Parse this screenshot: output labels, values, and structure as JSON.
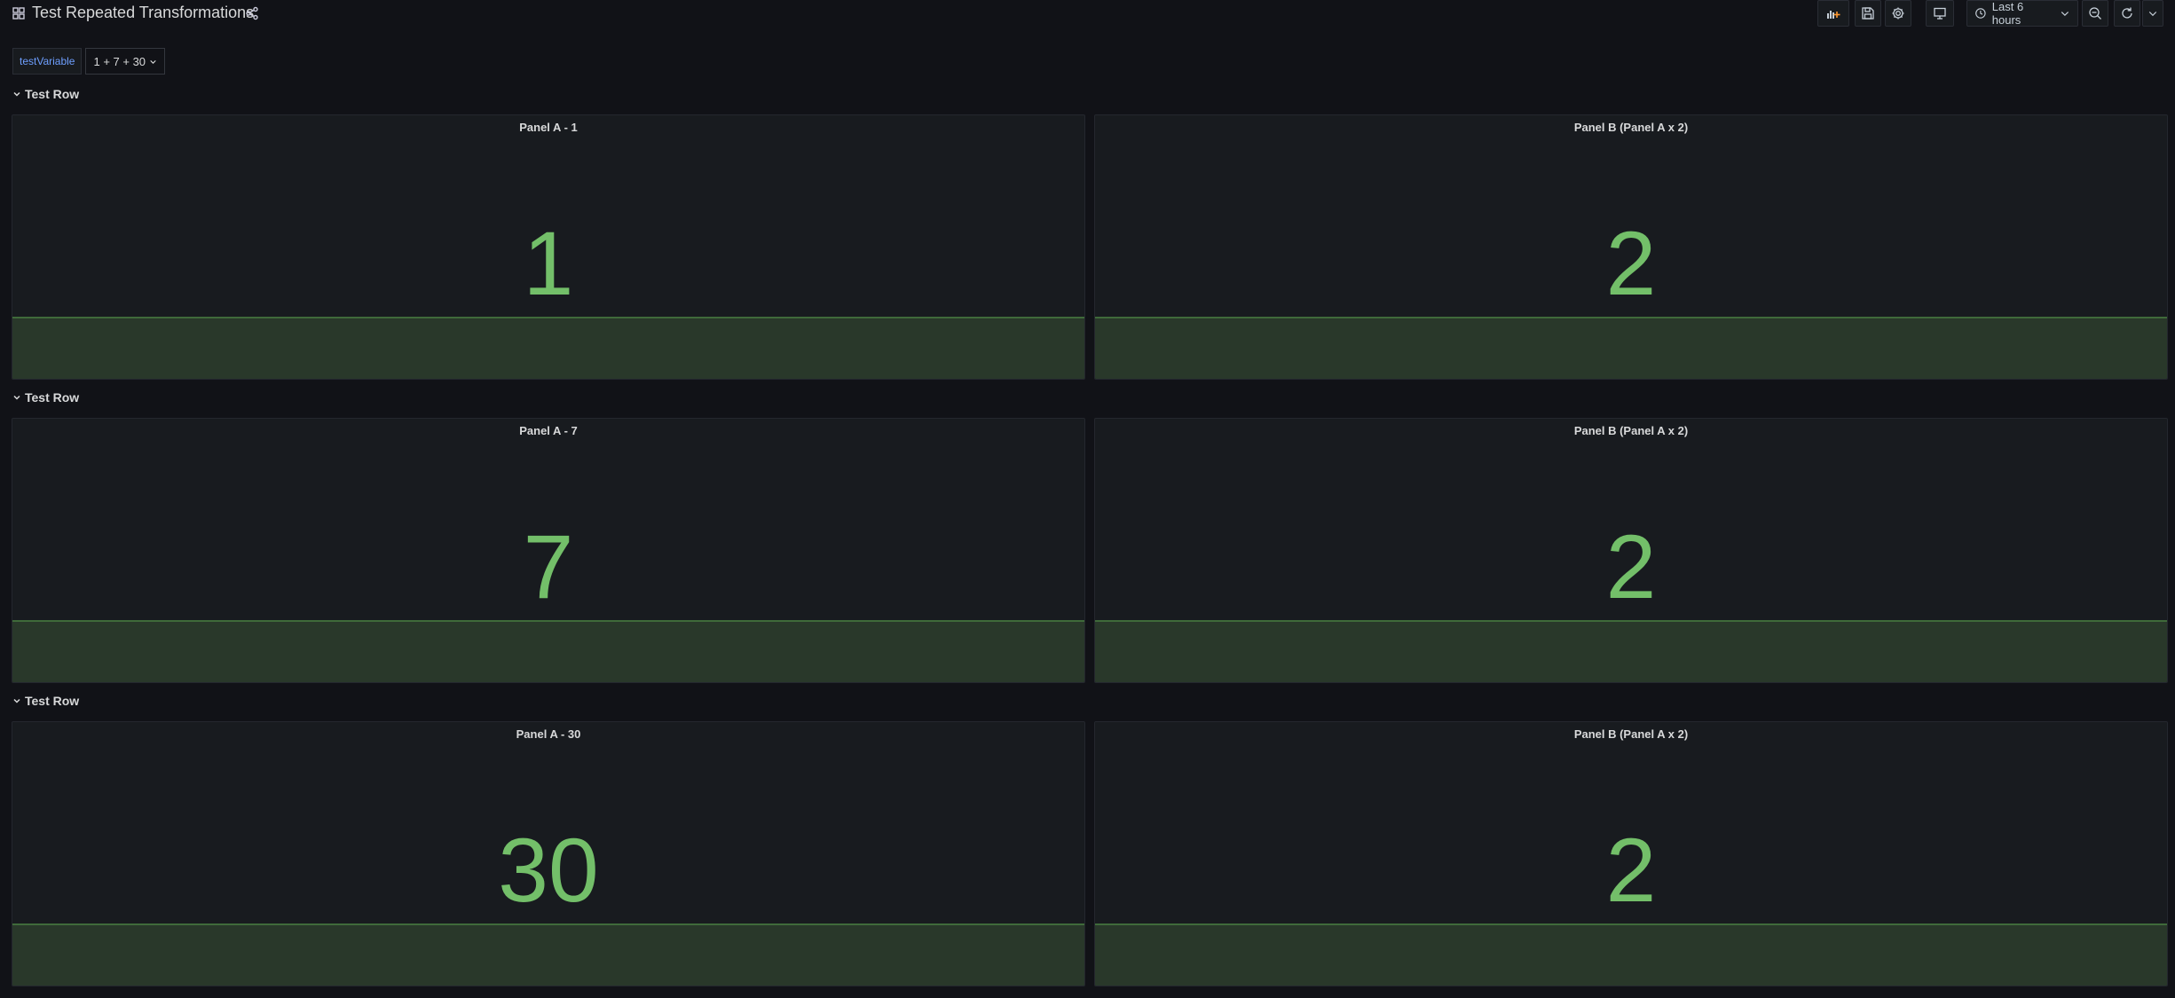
{
  "header": {
    "title": "Test Repeated Transformations",
    "icons": {
      "dashboard": "grid-icon",
      "share": "share-icon"
    },
    "toolbar": {
      "add_panel": "add-panel-icon",
      "save": "save-icon",
      "settings": "gear-icon",
      "tv_mode": "monitor-icon",
      "time_range": "Last 6 hours",
      "zoom_out": "zoom-out-icon",
      "refresh": "refresh-icon",
      "refresh_interval": "chevron-down-icon"
    }
  },
  "variables": [
    {
      "label": "testVariable",
      "value": "1 + 7 + 30"
    }
  ],
  "rows": [
    {
      "title": "Test Row",
      "panels": [
        {
          "title": "Panel A - 1",
          "value": "1"
        },
        {
          "title": "Panel B (Panel A x 2)",
          "value": "2"
        }
      ]
    },
    {
      "title": "Test Row",
      "panels": [
        {
          "title": "Panel A - 7",
          "value": "7"
        },
        {
          "title": "Panel B (Panel A x 2)",
          "value": "2"
        }
      ]
    },
    {
      "title": "Test Row",
      "panels": [
        {
          "title": "Panel A - 30",
          "value": "30"
        },
        {
          "title": "Panel B (Panel A x 2)",
          "value": "2"
        }
      ]
    }
  ],
  "colors": {
    "background": "#111217",
    "panel": "#181b1f",
    "value": "#73bf69",
    "sparkline_fill": "#29382a",
    "variable_label": "#6e9fff"
  }
}
